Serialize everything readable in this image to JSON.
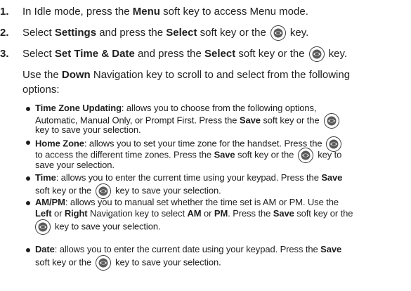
{
  "steps": [
    {
      "num": "1.",
      "pre": "In Idle mode, press the ",
      "key": "Menu",
      "post": " soft key to access Menu mode."
    },
    {
      "num": "2.",
      "pre": "Select ",
      "item": "Settings",
      "mid": " and press the ",
      "key": "Select",
      "post": " soft key or the",
      "end": "key."
    },
    {
      "num": "3.",
      "pre": "Select ",
      "item": "Set Time & Date",
      "mid": " and press the ",
      "key": "Select",
      "post": " soft key or the",
      "end": "key."
    }
  ],
  "intro": {
    "line1_pre": "Use the ",
    "line1_key": "Down",
    "line1_post": " Navigation key to scroll to and select from the following",
    "line2": "options:"
  },
  "bullets": {
    "tz": {
      "label": "Time Zone Updating",
      "l1": ": allows you to choose from the following options,",
      "l2a": "Automatic, Manual Only, or Prompt First. Press the ",
      "l2b": "Save",
      "l2c": " soft key or the",
      "l3": "key to save your selection."
    },
    "hz": {
      "label": "Home Zone",
      "l1": ": allows you to set your time zone for the handset. Press the",
      "l2a": "to access the different time zones. Press the ",
      "l2b": "Save",
      "l2c": " soft key or the",
      "l2d": "key to",
      "l3": "save your selection."
    },
    "time": {
      "label": "Time",
      "l1": ": allows you to enter the current time using your keypad. Press the ",
      "l1b": "Save",
      "l2a": "soft key or the",
      "l2b": "key to save your selection."
    },
    "ampm": {
      "label": "AM/PM",
      "l1": ": allows you to manual set whether the time set is AM or PM. Use the",
      "l2a": "Left",
      "l2b": " or ",
      "l2c": "Right",
      "l2d": " Navigation key to select ",
      "l2e": "AM",
      "l2f": " or ",
      "l2g": "PM",
      "l2h": ". Press the ",
      "l2i": "Save",
      "l2j": " soft key or the",
      "l3": "key to save your selection."
    },
    "date": {
      "label": "Date",
      "l1": ": allows you to enter the current date using your keypad. Press the ",
      "l1b": "Save",
      "l2a": "soft key or the",
      "l2b": "key to save your selection."
    }
  },
  "icons": {
    "ok_key": "ok-key-icon"
  }
}
